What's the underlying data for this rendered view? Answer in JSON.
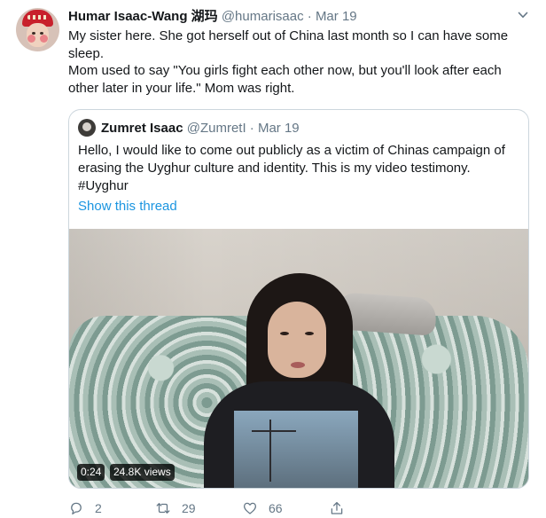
{
  "tweet": {
    "author_name": "Humar Isaac-Wang 湖玛",
    "handle": "@humarisaac",
    "separator": "·",
    "date": "Mar 19",
    "text_line1": "My sister here. She got herself out of China last month so I can have some sleep.",
    "text_line2": "Mom used to say \"You girls fight each other now, but you'll look after each other later in your life.\" Mom was right."
  },
  "quote": {
    "author_name": "Zumret Isaac",
    "handle": "@ZumretI",
    "separator": "·",
    "date": "Mar 19",
    "text_main": "Hello, I would like to come out publicly as a victim of Chinas campaign of erasing the Uyghur culture and identity. This is my video testimony.",
    "hashtag": "#Uyghur",
    "show_thread": "Show this thread",
    "video": {
      "time": "0:24",
      "views": "24.8K views"
    }
  },
  "actions": {
    "reply_count": "2",
    "retweet_count": "29",
    "like_count": "66"
  },
  "icons": [
    "chevron-down-icon",
    "reply-icon",
    "retweet-icon",
    "like-icon",
    "share-icon"
  ],
  "colors": {
    "link": "#1b95e0",
    "muted": "#657786",
    "border": "#ccd6dd"
  }
}
